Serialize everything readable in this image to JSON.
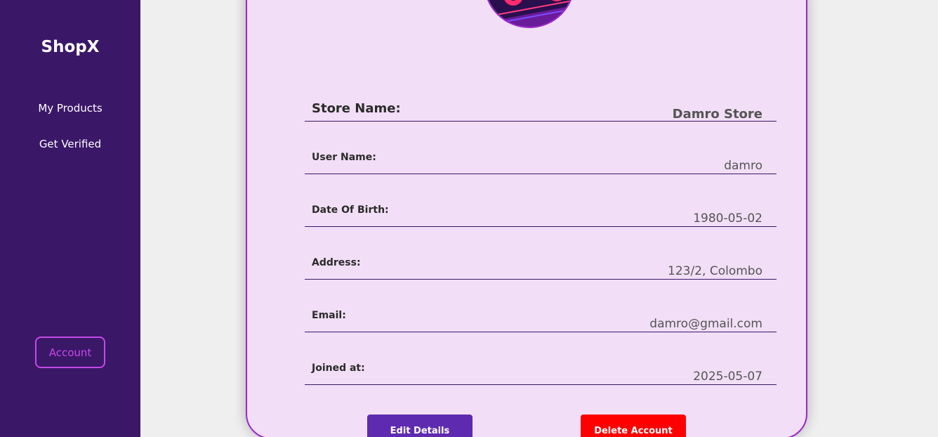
{
  "sidebar": {
    "brand": "ShopX",
    "items": [
      {
        "label": "My Products"
      },
      {
        "label": "Get Verified"
      }
    ],
    "account_label": "Account"
  },
  "profile": {
    "store_name_label": "Store Name:",
    "store_name": "Damro Store",
    "fields": [
      {
        "label": "User Name:",
        "value": "damro"
      },
      {
        "label": "Date Of Birth:",
        "value": "1980-05-02"
      },
      {
        "label": "Address:",
        "value": "123/2, Colombo"
      },
      {
        "label": "Email:",
        "value": "damro@gmail.com"
      },
      {
        "label": "Joined at:",
        "value": "2025-05-07"
      }
    ],
    "edit_label": "Edit Details",
    "delete_label": "Delete Account"
  },
  "colors": {
    "sidebar_bg": "#3b1768",
    "accent": "#9d27c9",
    "card_bg": "#f2def6",
    "edit_button": "#5e2bb0",
    "delete_button": "#ff0000"
  }
}
